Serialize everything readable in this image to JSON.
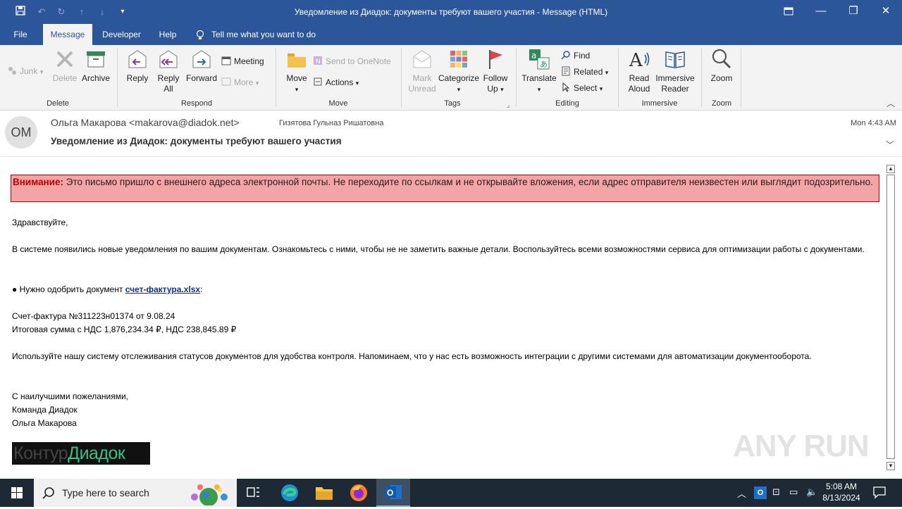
{
  "window": {
    "title": "Уведомление из Диадок: документы требуют вашего участия  -  Message (HTML)"
  },
  "menu": {
    "file": "File",
    "message": "Message",
    "developer": "Developer",
    "help": "Help",
    "tell_me": "Tell me what you want to do"
  },
  "ribbon": {
    "delete_group": {
      "label": "Delete",
      "junk": "Junk",
      "delete": "Delete",
      "archive": "Archive"
    },
    "respond_group": {
      "label": "Respond",
      "reply": "Reply",
      "reply_all_1": "Reply",
      "reply_all_2": "All",
      "forward": "Forward",
      "meeting": "Meeting",
      "more": "More"
    },
    "move_group": {
      "label": "Move",
      "move": "Move",
      "send_onenote": "Send to OneNote",
      "actions": "Actions"
    },
    "tags_group": {
      "label": "Tags",
      "mark_unread_1": "Mark",
      "mark_unread_2": "Unread",
      "categorize": "Categorize",
      "follow_up_1": "Follow",
      "follow_up_2": "Up"
    },
    "editing_group": {
      "label": "Editing",
      "translate": "Translate",
      "find": "Find",
      "related": "Related",
      "select": "Select"
    },
    "immersive_group": {
      "label": "Immersive",
      "read_aloud_1": "Read",
      "read_aloud_2": "Aloud",
      "immersive_reader_1": "Immersive",
      "immersive_reader_2": "Reader"
    },
    "zoom_group": {
      "label": "Zoom",
      "zoom": "Zoom"
    }
  },
  "message": {
    "avatar_initials": "ОМ",
    "from": "Ольга Макарова <makarova@diadok.net>",
    "to": "Гизятова Гульназ Ришатовна",
    "time": "Mon 4:43 AM",
    "subject": "Уведомление из Диадок: документы требуют вашего участия"
  },
  "body": {
    "warning_bold": "Внимание:",
    "warning_text": " Это письмо пришло с внешнего адреса электронной почты. Не переходите по ссылкам и не открывайте вложения, если адрес отправителя неизвестен или выглядит подозрительно.",
    "greeting": "Здравствуйте,",
    "para1": "В системе появились новые уведомления по вашим документам. Ознакомьтесь с ними, чтобы не не заметить важные детали. Воспользуйтесь всеми возможностями сервиса для оптимизации работы с документами.",
    "bullet_prefix": "● Нужно одобрить документ ",
    "bullet_link": "счет-фактура.xlsx",
    "bullet_suffix": ":",
    "invoice_line": "Счет-фактура №311223н01374  от 9.08.24",
    "total_line": "Итоговая сумма с НДС 1,876,234.34  ₽, НДС 238,845.89  ₽",
    "para2": "Используйте нашу систему отслеживания статусов документов для удобства контроля. Напоминаем, что у нас есть возможность интеграции с другими системами для автоматизации документооборота.",
    "sign1": "С наилучшими пожеланиями,",
    "sign2": "Команда Диадок",
    "sign3": "Ольга Макарова",
    "logo_part1": "Контур",
    "logo_part2": "Диадок"
  },
  "watermark": {
    "text": "ANY RUN"
  },
  "taskbar": {
    "search_placeholder": "Type here to search",
    "time": "5:08 AM",
    "date": "8/13/2024"
  },
  "colors": {
    "title_blue": "#2b579a",
    "warning_bg": "#f3a4a4",
    "warning_border": "#c00000",
    "link_blue": "#0b2f9c",
    "logo_green": "#35c28a"
  },
  "icons": [
    "save-icon",
    "undo-icon",
    "redo-icon",
    "up-icon",
    "down-icon",
    "customize-icon",
    "restore-icon",
    "minimize-icon",
    "maximize-icon",
    "close-icon",
    "lightbulb-icon",
    "junk-icon",
    "delete-icon",
    "archive-icon",
    "reply-icon",
    "reply-all-icon",
    "forward-icon",
    "meeting-icon",
    "more-icon",
    "move-icon",
    "onenote-icon",
    "actions-icon",
    "mark-unread-icon",
    "categorize-icon",
    "flag-icon",
    "translate-icon",
    "find-icon",
    "related-icon",
    "select-icon",
    "read-aloud-icon",
    "immersive-reader-icon",
    "zoom-icon",
    "chevron-down-icon",
    "windows-icon",
    "search-icon",
    "task-view-icon",
    "edge-icon",
    "explorer-icon",
    "firefox-icon",
    "outlook-icon",
    "notification-icon"
  ]
}
